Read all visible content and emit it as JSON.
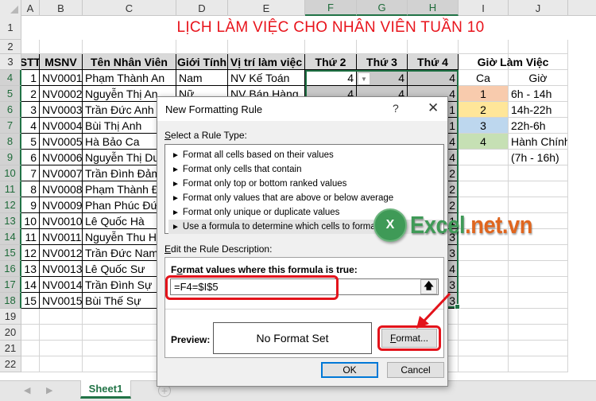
{
  "spreadsheet": {
    "columns": [
      "A",
      "B",
      "C",
      "D",
      "E",
      "F",
      "G",
      "H",
      "I",
      "J"
    ],
    "selected_columns": [
      "F",
      "G",
      "H"
    ],
    "rows": [
      "1",
      "2",
      "3",
      "4",
      "5",
      "6",
      "7",
      "8",
      "9",
      "10",
      "11",
      "12",
      "13",
      "14",
      "15",
      "16",
      "17",
      "18",
      "19",
      "20",
      "21",
      "22"
    ],
    "title": "LỊCH LÀM VIỆC CHO NHÂN VIÊN TUẦN 10",
    "headers": [
      "STT",
      "MSNV",
      "Tên Nhân Viên",
      "Giới Tính",
      "Vị trí làm việc",
      "Thứ 2",
      "Thứ 3",
      "Thứ 4"
    ],
    "employees": [
      {
        "stt": "1",
        "msnv": "NV0001",
        "name": "Phạm Thành An",
        "gender": "Nam",
        "position": "NV Kế Toán",
        "t2": "4",
        "t3": "4",
        "t4": "4"
      },
      {
        "stt": "2",
        "msnv": "NV0002",
        "name": "Nguyễn Thị An",
        "gender": "Nữ",
        "position": "NV Bán Hàng",
        "t2": "4",
        "t3": "4",
        "t4": "4"
      },
      {
        "stt": "3",
        "msnv": "NV0003",
        "name": "Trần Đức Anh",
        "t4": "1"
      },
      {
        "stt": "4",
        "msnv": "NV0004",
        "name": "Bùi Thị Anh",
        "t4": "1"
      },
      {
        "stt": "5",
        "msnv": "NV0005",
        "name": "Hà Bảo Ca",
        "t4": "4"
      },
      {
        "stt": "6",
        "msnv": "NV0006",
        "name": "Nguyễn Thị Du",
        "t4": "4"
      },
      {
        "stt": "7",
        "msnv": "NV0007",
        "name": "Trần Đình Đảm",
        "t4": "2"
      },
      {
        "stt": "8",
        "msnv": "NV0008",
        "name": "Phạm Thành Đ",
        "t4": "2"
      },
      {
        "stt": "9",
        "msnv": "NV0009",
        "name": "Phan Phúc Đức",
        "t4": "2"
      },
      {
        "stt": "10",
        "msnv": "NV0010",
        "name": "Lê Quốc Hà",
        "t4": "1"
      },
      {
        "stt": "11",
        "msnv": "NV0011",
        "name": "Nguyễn Thu Hà",
        "t4": "3"
      },
      {
        "stt": "12",
        "msnv": "NV0012",
        "name": "Trần Đức Nam",
        "t4": "3"
      },
      {
        "stt": "13",
        "msnv": "NV0013",
        "name": "Lê Quốc Sư",
        "t4": "4"
      },
      {
        "stt": "14",
        "msnv": "NV0014",
        "name": "Trần Đình Sự",
        "t4": "3"
      },
      {
        "stt": "15",
        "msnv": "NV0015",
        "name": "Bùi Thế Sự",
        "t4": "3"
      }
    ],
    "shift_table": {
      "title": "Giờ Làm Việc",
      "col_ca": "Ca",
      "col_gio": "Giờ",
      "shifts": [
        {
          "ca": "1",
          "gio": "6h - 14h",
          "color": "#f8cbad"
        },
        {
          "ca": "2",
          "gio": "14h-22h",
          "color": "#ffe699"
        },
        {
          "ca": "3",
          "gio": "22h-6h",
          "color": "#bdd7ee"
        },
        {
          "ca": "4",
          "gio": "Hành Chính",
          "color": "#c6e0b4"
        }
      ],
      "note": "(7h - 16h)"
    },
    "sheet_tab": "Sheet1",
    "accent": "#217346"
  },
  "dialog": {
    "title": "New Formatting Rule",
    "help": "?",
    "close": "✕",
    "select_rule_label": "Select a Rule Type:",
    "rule_types": [
      "Format all cells based on their values",
      "Format only cells that contain",
      "Format only top or bottom ranked values",
      "Format only values that are above or below average",
      "Format only unique or duplicate values",
      "Use a formula to determine which cells to format"
    ],
    "selected_rule_index": 5,
    "edit_label": "Edit the Rule Description:",
    "formula_label": "Format values where this formula is true:",
    "formula_value": "=F4=$I$5",
    "preview_label": "Preview:",
    "preview_text": "No Format Set",
    "format_button": "Format...",
    "ok_button": "OK",
    "cancel_button": "Cancel",
    "highlight_color": "#e3131b"
  },
  "watermark": {
    "part1": "Excel",
    "part2": ".net.vn",
    "logo": "X"
  }
}
